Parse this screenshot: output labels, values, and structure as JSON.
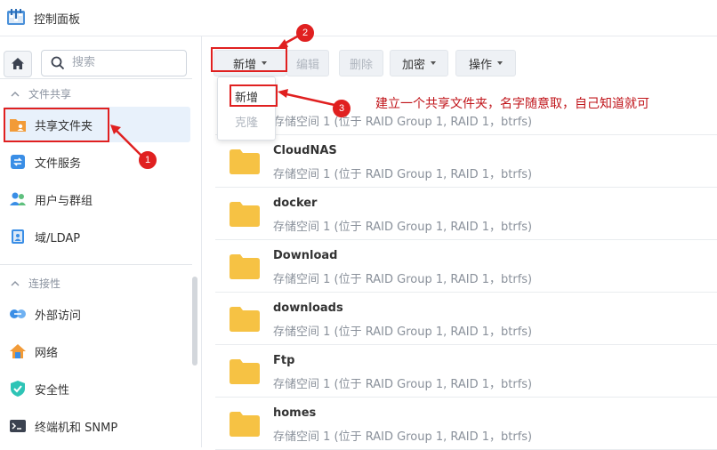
{
  "window": {
    "title": "控制面板"
  },
  "sidebar": {
    "search_placeholder": "搜索",
    "sections": [
      {
        "header": "文件共享",
        "items": [
          {
            "label": "共享文件夹",
            "icon": "shared-folder-icon",
            "active": true
          },
          {
            "label": "文件服务",
            "icon": "file-services-icon"
          },
          {
            "label": "用户与群组",
            "icon": "users-icon"
          },
          {
            "label": "域/LDAP",
            "icon": "domain-ldap-icon"
          }
        ]
      },
      {
        "header": "连接性",
        "items": [
          {
            "label": "外部访问",
            "icon": "external-access-icon"
          },
          {
            "label": "网络",
            "icon": "network-icon"
          },
          {
            "label": "安全性",
            "icon": "security-shield-icon"
          },
          {
            "label": "终端机和 SNMP",
            "icon": "terminal-snmp-icon"
          }
        ]
      }
    ]
  },
  "toolbar": {
    "create_label": "新增",
    "edit_label": "编辑",
    "delete_label": "删除",
    "encrypt_label": "加密",
    "action_label": "操作"
  },
  "dropdown": {
    "items": [
      {
        "label": "新增",
        "enabled": true
      },
      {
        "label": "克隆",
        "enabled": false
      }
    ]
  },
  "folders": [
    {
      "name": "",
      "desc": "存储空间 1 (位于 RAID Group 1, RAID 1，btrfs)"
    },
    {
      "name": "CloudNAS",
      "desc": "存储空间 1 (位于 RAID Group 1, RAID 1，btrfs)"
    },
    {
      "name": "docker",
      "desc": "存储空间 1 (位于 RAID Group 1, RAID 1，btrfs)"
    },
    {
      "name": "Download",
      "desc": "存储空间 1 (位于 RAID Group 1, RAID 1，btrfs)"
    },
    {
      "name": "downloads",
      "desc": "存储空间 1 (位于 RAID Group 1, RAID 1，btrfs)"
    },
    {
      "name": "Ftp",
      "desc": "存储空间 1 (位于 RAID Group 1, RAID 1，btrfs)"
    },
    {
      "name": "homes",
      "desc": "存储空间 1 (位于 RAID Group 1, RAID 1，btrfs)"
    }
  ],
  "annotations": {
    "step1": "1",
    "step2": "2",
    "step3": "3",
    "note": "建立一个共享文件夹，名字随意取，自己知道就可"
  },
  "colors": {
    "annotation_red": "#e02020",
    "folder_yellow": "#f6c244",
    "active_bg": "#e8f1fb"
  }
}
